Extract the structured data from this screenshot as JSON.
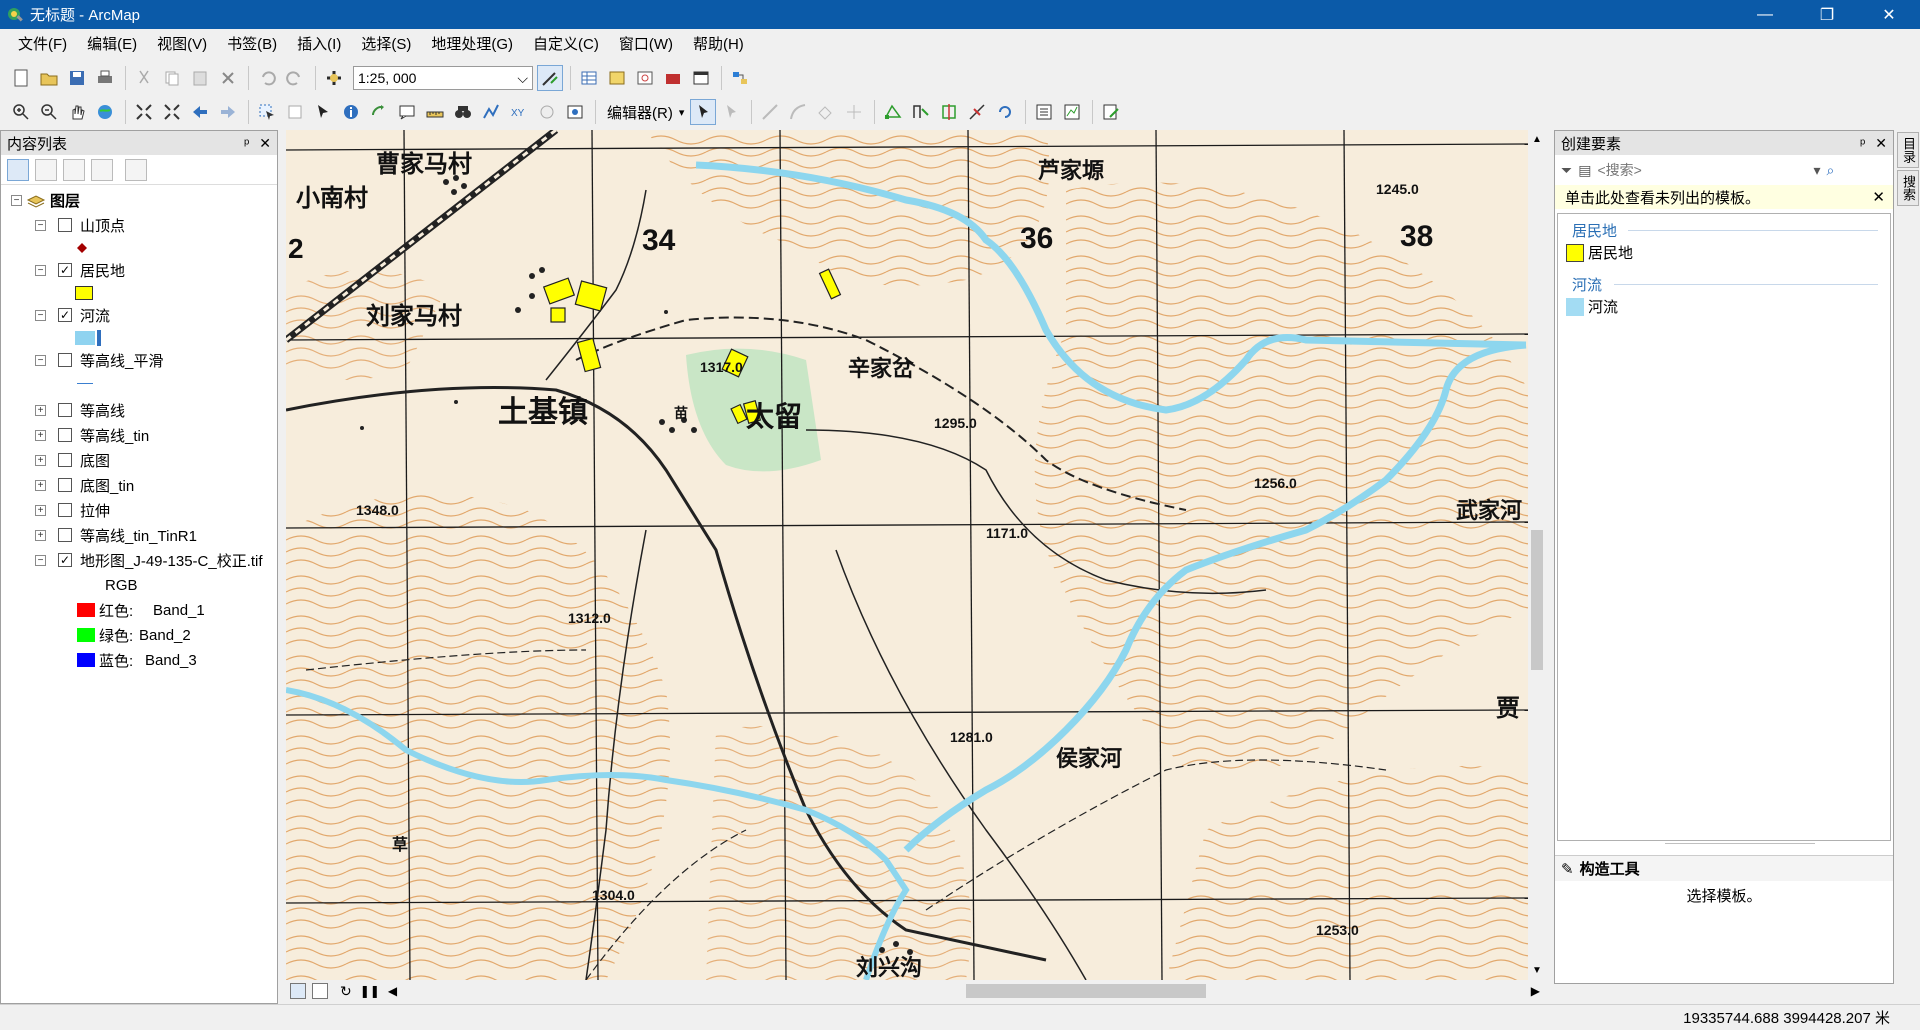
{
  "window": {
    "title": "无标题 - ArcMap",
    "min": "—",
    "restore": "❐",
    "close": "✕"
  },
  "menu": [
    "文件(F)",
    "编辑(E)",
    "视图(V)",
    "书签(B)",
    "插入(I)",
    "选择(S)",
    "地理处理(G)",
    "自定义(C)",
    "窗口(W)",
    "帮助(H)"
  ],
  "toolbar": {
    "scale": "1:25, 000",
    "editor_label": "编辑器(R)"
  },
  "toc": {
    "title": "内容列表",
    "root": "图层",
    "layers": [
      {
        "name": "山顶点",
        "checked": false
      },
      {
        "name": "居民地",
        "checked": true
      },
      {
        "name": "河流",
        "checked": true
      },
      {
        "name": "等高线_平滑",
        "checked": false
      },
      {
        "name": "等高线",
        "checked": false
      },
      {
        "name": "等高线_tin",
        "checked": false
      },
      {
        "name": "底图",
        "checked": false
      },
      {
        "name": "底图_tin",
        "checked": false
      },
      {
        "name": "拉伸",
        "checked": false
      },
      {
        "name": "等高线_tin_TinR1",
        "checked": false
      },
      {
        "name": "地形图_J-49-135-C_校正.tif",
        "checked": true
      }
    ],
    "rgb_label": "RGB",
    "bands": [
      {
        "label": "红色:",
        "band": "Band_1",
        "color": "#ff0000"
      },
      {
        "label": "绿色:",
        "band": "Band_2",
        "color": "#00ff00"
      },
      {
        "label": "蓝色:",
        "band": "Band_3",
        "color": "#0000ff"
      }
    ]
  },
  "map": {
    "places": [
      "曹家马村",
      "小南村",
      "刘家马村",
      "土基镇",
      "太留",
      "辛家岔",
      "芦家塬",
      "武家河",
      "侯家河",
      "刘兴沟",
      "贾",
      "苗",
      "草"
    ],
    "grid_labels": [
      "34",
      "36",
      "38",
      "2"
    ],
    "elevations": [
      "1317.0",
      "1295.0",
      "1348.0",
      "1256.0",
      "1171.0",
      "1245.0",
      "1312.0",
      "1281.0",
      "1304.0",
      "1253.0"
    ],
    "colors": {
      "settlement": "#ffff00",
      "river": "#7fd4ef",
      "contour": "#d98a3a",
      "paper": "#f7eddc"
    }
  },
  "create_features": {
    "title": "创建要素",
    "search_placeholder": "<搜索>",
    "note": "单击此处查看未列出的模板。",
    "groups": [
      {
        "group": "居民地",
        "template": "居民地",
        "color": "#ffff00"
      },
      {
        "group": "河流",
        "template": "河流",
        "color": "#a3dcf3"
      }
    ],
    "tools_title": "构造工具",
    "tools_hint": "选择模板。"
  },
  "side_tabs": [
    "目录",
    "搜索"
  ],
  "status": {
    "coords": "19335744.688  3994428.207 米"
  }
}
